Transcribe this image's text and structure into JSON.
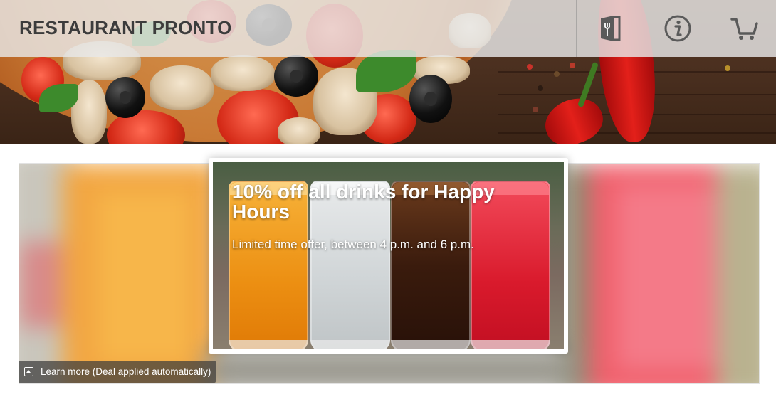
{
  "header": {
    "brand": "RESTAURANT PRONTO",
    "menu_icon": "menu-book-icon",
    "info_icon": "info-icon",
    "cart_icon": "cart-icon"
  },
  "promo": {
    "title": "10% off all drinks for Happy Hours",
    "subtitle": "Limited time offer, between 4 p.m. and 6 p.m.",
    "learn_more": "Learn more (Deal applied automatically)",
    "learn_more_icon": "expand-up-icon"
  },
  "colors": {
    "header_text": "#3c3c3c",
    "header_bg": "#e8e8e8",
    "overlay_bar": "#3c3c3c"
  }
}
